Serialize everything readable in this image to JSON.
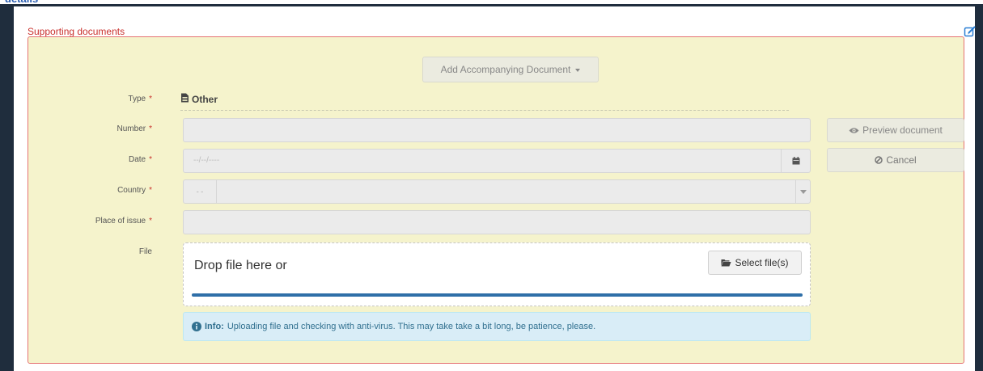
{
  "page": {
    "cut_title": "details"
  },
  "section": {
    "title": "Supporting documents",
    "edit_icon": "edit-icon"
  },
  "toolbar": {
    "add_label": "Add Accompanying Document"
  },
  "form": {
    "type": {
      "label": "Type",
      "required": "*",
      "value": "Other",
      "icon": "file-icon"
    },
    "number": {
      "label": "Number",
      "required": "*",
      "value": ""
    },
    "date": {
      "label": "Date",
      "required": "*",
      "placeholder": "--/--/----",
      "icon": "calendar-icon"
    },
    "country": {
      "label": "Country",
      "required": "*",
      "flag_placeholder": "- -",
      "value": ""
    },
    "place": {
      "label": "Place of issue",
      "required": "*",
      "value": ""
    },
    "file": {
      "label": "File",
      "drop_text": "Drop file here or",
      "select_label": "Select file(s)",
      "upload_progress": 1.0
    }
  },
  "info": {
    "title": "Info:",
    "text": "Uploading file and checking with anti-virus. This may take take a bit long, be patience, please."
  },
  "actions": {
    "preview_label": "Preview document",
    "cancel_label": "Cancel"
  },
  "colors": {
    "panel_bg": "#f5f3cc",
    "border_red": "#e57373",
    "header_red": "#c9302c",
    "info_blue": "#31708f",
    "progress": "#2f6fa8"
  }
}
